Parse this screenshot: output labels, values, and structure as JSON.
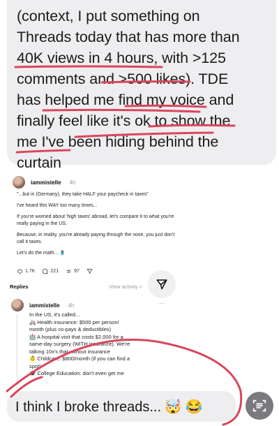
{
  "message": {
    "lines": [
      "(context, I put something on",
      "Threads today that has more than",
      "40K views in 4 hours, with >125",
      "comments and >500 likes).  TDE",
      "has helped me find my voice and",
      "finally feel like it's ok to show the",
      "me I've been hiding behind the",
      "curtain"
    ]
  },
  "threads": {
    "username": "iammistelle",
    "post_time": "4h",
    "post_paragraphs": [
      "\"...but in (Germany), they take HALF your paycheck in taxes\"",
      "I've heard this WAY too many times...",
      "If you're worried about 'high taxes' abroad, let's compare it to what you're really paying in the US.",
      "Because, in reality, you're already paying through the nose, you just don't call it taxes.",
      "Let's do the math... 🧵"
    ],
    "likes": "1.7K",
    "comments": "221",
    "reposts": "97",
    "replies_title": "Replies",
    "view_activity": "View activity >",
    "reply": {
      "username": "iammistelle",
      "time": "4h",
      "more": "···",
      "lines": [
        "In the US, it's called...",
        "🚑 Health insurance: $500 per person/",
        "month (plus co-pays & deductibles)",
        "🏥 A hospital visit that costs $2,000 for a",
        "same-day surgery (WITH insurance). We're",
        "talking 10x's that without insurance",
        "👶 Childcare: $800/month (if you can find a",
        "spot)",
        "🎓 College Education: don't even get me"
      ]
    }
  },
  "bottom_message": {
    "text": "I think I broke threads...",
    "emojis": "🤯 😂"
  },
  "colors": {
    "bubble": "#eeeef0",
    "scribble": "#d9465d"
  }
}
